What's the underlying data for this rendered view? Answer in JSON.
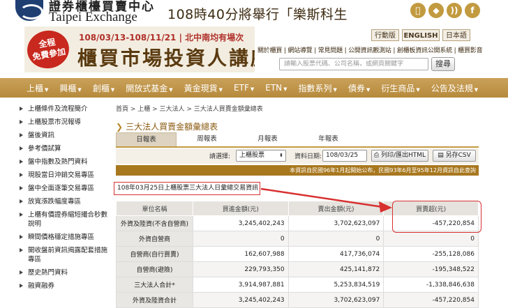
{
  "header": {
    "logo_cn": "證券櫃檯買賣中心",
    "logo_en": "Taipei Exchange",
    "marquee": "108時40分將舉行「樂斯科生",
    "social": [
      {
        "icon": "apple-icon",
        "glyph": ""
      },
      {
        "icon": "android-icon",
        "glyph": "◆"
      },
      {
        "icon": "rss-icon",
        "glyph": "))"
      },
      {
        "icon": "facebook-icon",
        "glyph": "f"
      }
    ]
  },
  "banner": {
    "dates": "108/03/13-108/11/21 | 北中南均有場次",
    "title": "櫃買市場投資人講座",
    "badge_line1": "全程",
    "badge_line2": "免費參加"
  },
  "lang": {
    "mobile": "行動版",
    "english": "ENGLISH",
    "japanese": "日本語"
  },
  "toplinks": "關於櫃買 | 網站導覽 | 常見問題 | 公開資訊觀測站 | 創櫃板資訊公開系統 | 櫃買影音",
  "search": {
    "placeholder": "請輸入股票代碼、公司名稱，或網頁關鍵字",
    "button": "搜尋"
  },
  "nav": [
    "上櫃",
    "興櫃",
    "創櫃",
    "開放式基金",
    "黃金現貨",
    "ETF",
    "ETN",
    "指數系列",
    "債券",
    "衍生商品",
    "公告及法規"
  ],
  "sidebar": [
    "上櫃條件及流程簡介",
    "上櫃股票市況報導",
    "盤後資訊",
    "參考價試算",
    "盤中指數及熱門資料",
    "現股當日沖銷交易專區",
    "盤中全面逐筆交易專區",
    "放寬漲跌幅度專區",
    "上櫃有價證券縮短撮合秒數說明",
    "瞬間價格穩定措施專區",
    "開收盤前資訊揭露配套措施專區",
    "歷史熱門資料",
    "融資融券"
  ],
  "breadcrumb": "首頁 > 上櫃 > 三大法人 > 三大法人買賣金額彙總表",
  "page_title": "三大法人買賣金額彙總表",
  "tabs": [
    "日報表",
    "周報表",
    "月報表",
    "年報表"
  ],
  "controls": {
    "select_label": "請選擇:",
    "select_value": "上櫃股票",
    "date_label": "資料日期:",
    "date_value": "108/03/25",
    "print_label": "列印/匯出HTML",
    "csv_label": "另存CSV"
  },
  "notice": "本資訊自民國96年1月起開始公布，民國93年6月至95年12月資訊自此查詢",
  "info_text": "108年03月25日上櫃股票三大法人日彙總交易資訊",
  "table": {
    "headers": [
      "單位名稱",
      "買進金額(元)",
      "賣出金額(元)",
      "買賣超(元)"
    ],
    "rows": [
      [
        "外資及陸資(不含自營商)",
        "3,245,402,243",
        "3,702,623,097",
        "-457,220,854"
      ],
      [
        "外資自營商",
        "0",
        "0",
        "0"
      ],
      [
        "自營商(自行買賣)",
        "162,607,988",
        "417,736,074",
        "-255,128,086"
      ],
      [
        "自營商(避險)",
        "229,793,350",
        "425,141,872",
        "-195,348,522"
      ],
      [
        "三大法人合計*",
        "3,914,987,881",
        "5,253,834,519",
        "-1,338,846,638"
      ],
      [
        "外資及陸資合計",
        "3,245,402,243",
        "3,702,623,097",
        "-457,220,854"
      ]
    ]
  },
  "colors": {
    "gold": "#c29a3f",
    "nav": "#b68a3c",
    "notice": "#a8781f",
    "highlight": "#d83030"
  }
}
